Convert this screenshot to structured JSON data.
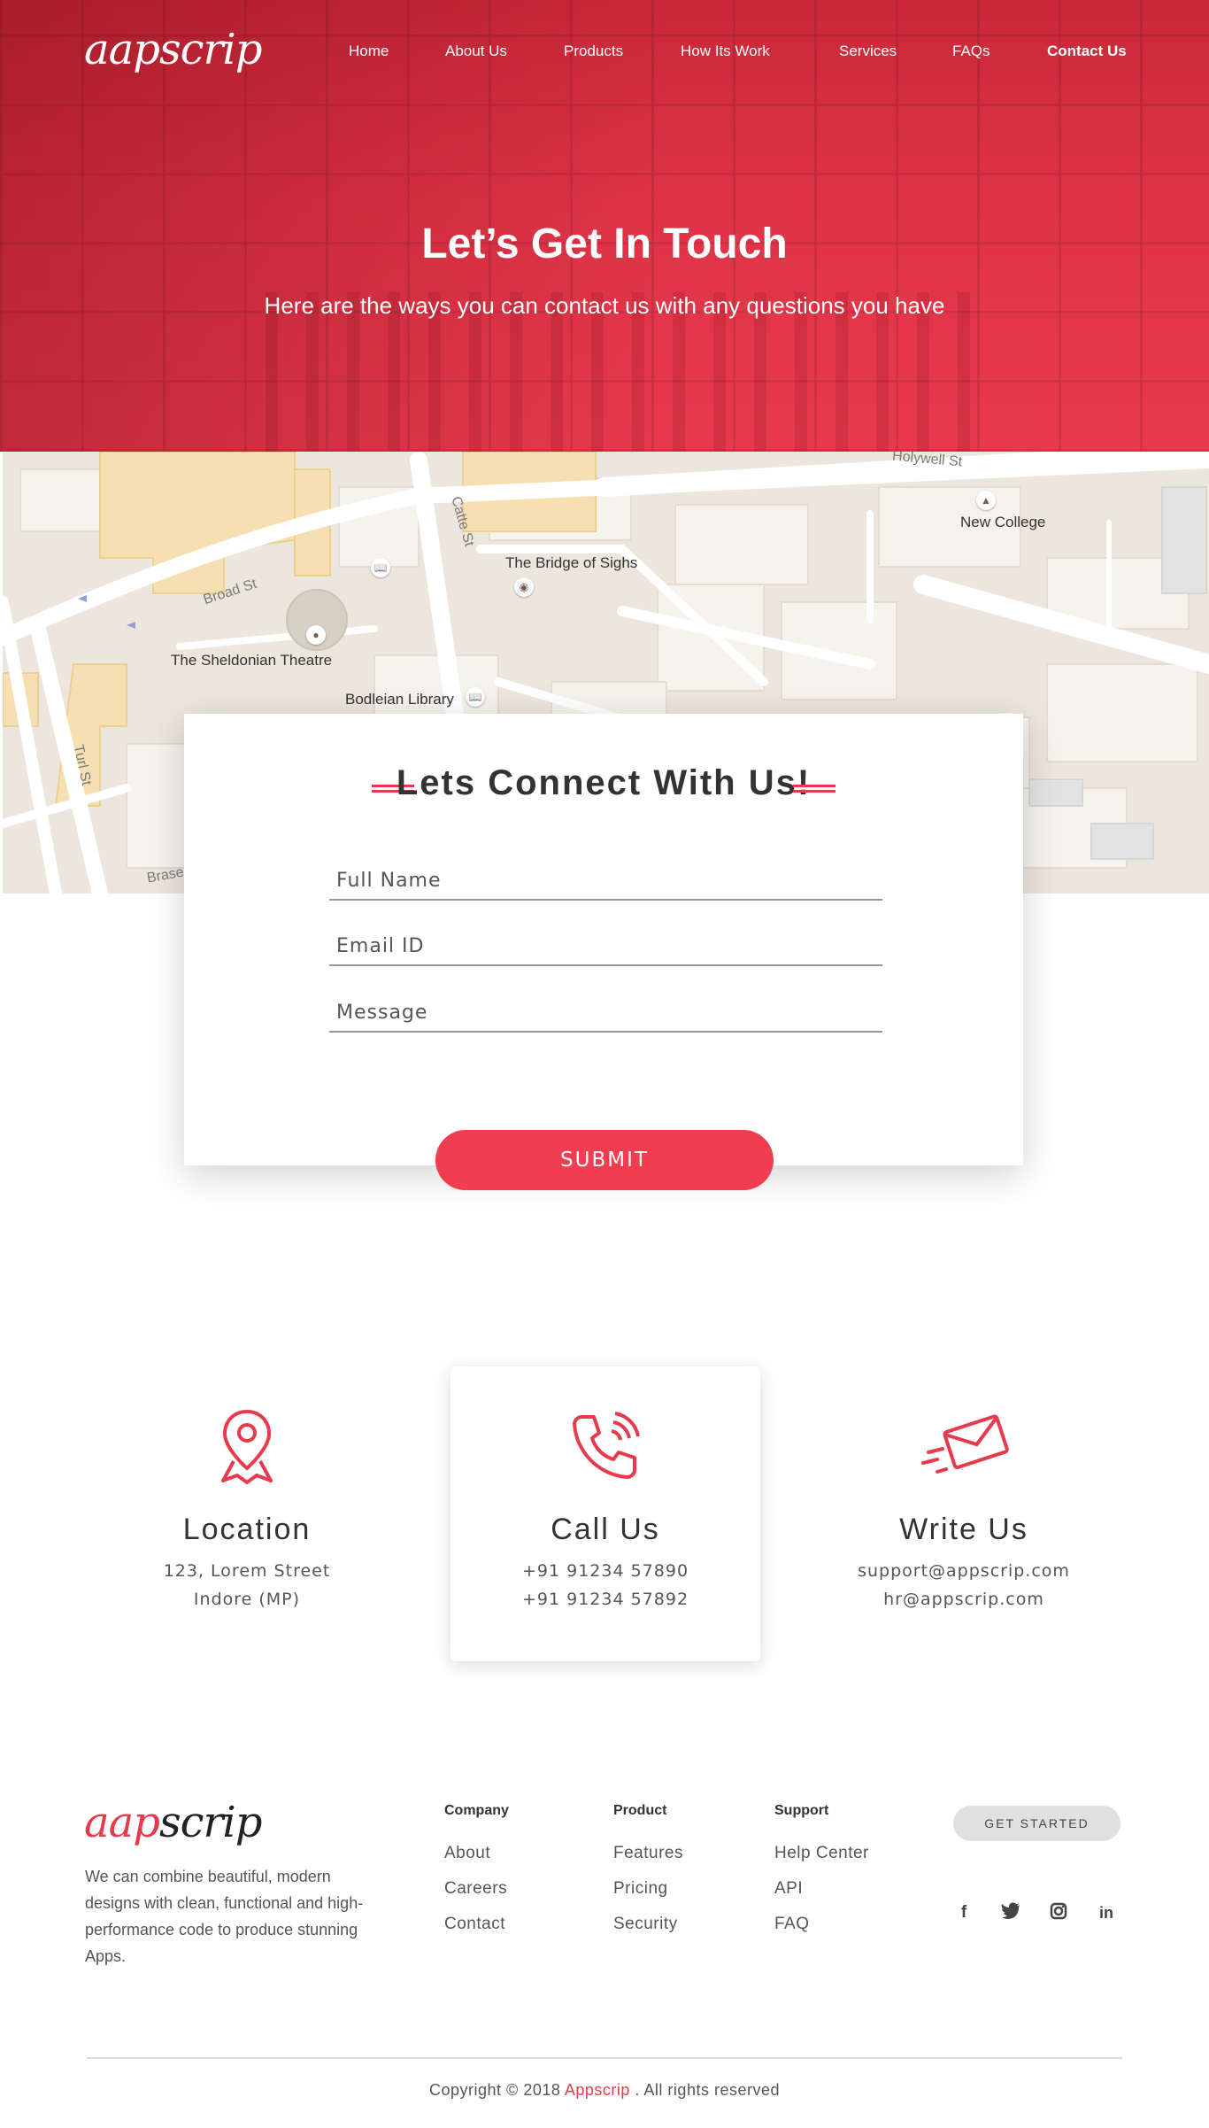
{
  "nav": {
    "logo": "aapscrip",
    "items": [
      {
        "label": "Home",
        "active": false
      },
      {
        "label": "About Us",
        "active": false
      },
      {
        "label": "Products",
        "active": false
      },
      {
        "label": "How Its Work",
        "active": false
      },
      {
        "label": "Services",
        "active": false
      },
      {
        "label": "FAQs",
        "active": false
      },
      {
        "label": "Contact Us",
        "active": true
      }
    ]
  },
  "hero": {
    "title": "Let’s Get In Touch",
    "subtitle": "Here are the ways you can contact us with any questions you have"
  },
  "map": {
    "places": [
      "New College",
      "The Bridge of Sighs",
      "The Sheldonian Theatre",
      "Bodleian Library"
    ],
    "streets": [
      "Holywell St",
      "Catte St",
      "Broad St",
      "Turl St",
      "Brase"
    ]
  },
  "form": {
    "title": "Lets Connect With Us!",
    "name_placeholder": "Full Name",
    "email_placeholder": "Email ID",
    "message_placeholder": "Message",
    "submit_label": "SUBMIT"
  },
  "contact": {
    "location": {
      "title": "Location",
      "line1": "123, Lorem Street",
      "line2": "Indore (MP)",
      "icon": "location-pin-icon"
    },
    "call": {
      "title": "Call Us",
      "line1": "+91 91234 57890",
      "line2": "+91 91234 57892",
      "icon": "phone-icon"
    },
    "write": {
      "title": "Write Us",
      "line1": "support@appscrip.com",
      "line2": "hr@appscrip.com",
      "icon": "envelope-icon"
    }
  },
  "footer": {
    "logo_red": "aap",
    "logo_dark": "scrip",
    "description": "We can combine beautiful, modern designs with clean, functional and high-performance code to produce stunning Apps.",
    "columns": [
      {
        "heading": "Company",
        "links": [
          "About",
          "Careers",
          "Contact"
        ]
      },
      {
        "heading": "Product",
        "links": [
          "Features",
          "Pricing",
          "Security"
        ]
      },
      {
        "heading": "Support",
        "links": [
          "Help Center",
          "API",
          "FAQ"
        ]
      }
    ],
    "cta_label": "GET STARTED",
    "social": [
      {
        "icon": "facebook-icon",
        "glyph": "f"
      },
      {
        "icon": "twitter-icon",
        "glyph": "🐦"
      },
      {
        "icon": "instagram-icon",
        "glyph": "◘"
      },
      {
        "icon": "linkedin-icon",
        "glyph": "in"
      }
    ],
    "copyright_prefix": "Copyright © 2018",
    "copyright_brand": "Appscrip",
    "copyright_suffix": ". All rights reserved"
  },
  "colors": {
    "accent": "#e83a4d",
    "button": "#f03d50"
  }
}
